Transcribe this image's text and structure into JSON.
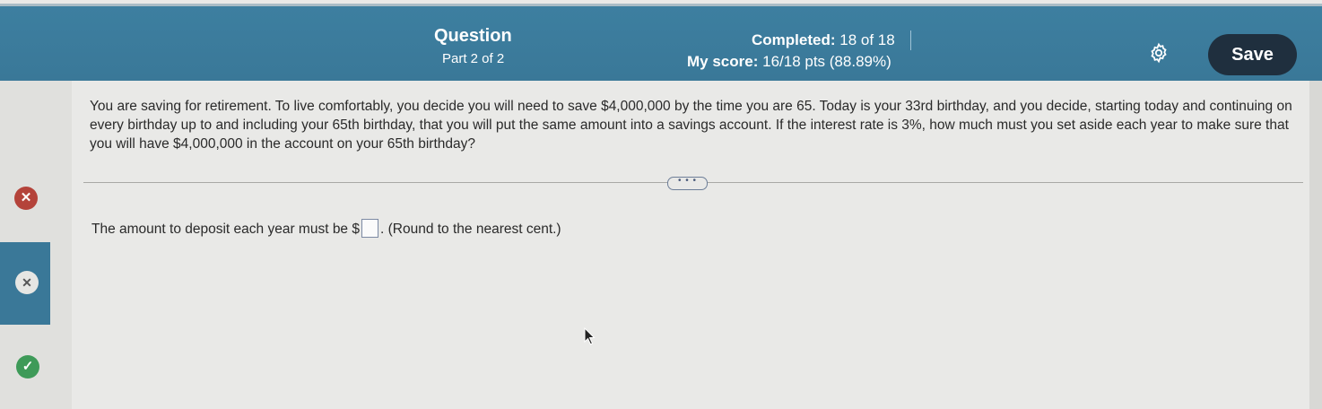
{
  "header": {
    "question_label": "Question",
    "part_label": "Part 2 of 2",
    "completed_prefix": "Completed:",
    "completed_value": "18 of 18",
    "score_prefix": "My score:",
    "score_value": "16/18 pts (88.89%)",
    "save_label": "Save",
    "settings_icon": "gear-icon"
  },
  "sidebar": {
    "items": [
      {
        "status": "incorrect",
        "icon": "x-icon",
        "glyph": "✕",
        "color": "#b4433a"
      },
      {
        "status": "incorrect-current",
        "icon": "x-icon",
        "glyph": "✕",
        "color": "#3a7898"
      },
      {
        "status": "correct",
        "icon": "check-icon",
        "glyph": "✓",
        "color": "#3e9a58"
      }
    ]
  },
  "main": {
    "question_text": "You are saving for retirement. To live comfortably, you decide you will need to save $4,000,000 by the time you are 65. Today is your 33rd birthday, and you decide, starting today and continuing on every birthday up to and including your 65th birthday, that you will put the same amount into a savings account. If the interest rate is 3%, how much must you set aside each year to make sure that you will have $4,000,000 in the account on your 65th birthday?",
    "more_label": "• • •",
    "answer_prefix": "The amount to deposit each year must be $",
    "answer_value": "",
    "answer_suffix": ". (Round to the nearest cent.)"
  },
  "colors": {
    "header_bg": "#3a7898",
    "save_bg": "#1f2f3e",
    "incorrect": "#b4433a",
    "correct": "#3e9a58"
  }
}
